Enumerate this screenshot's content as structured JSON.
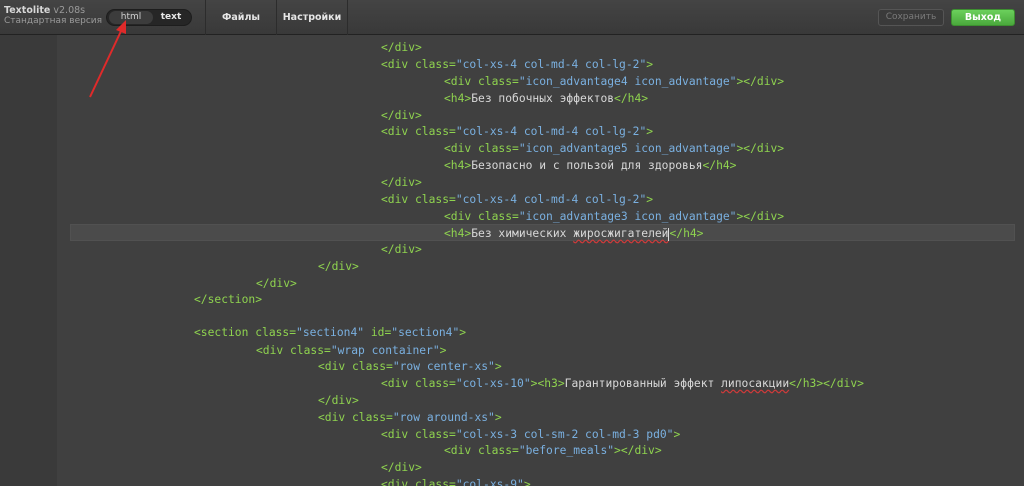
{
  "app": {
    "name": "Textolite",
    "version": "v2.08s",
    "edition": "Стандартная версия"
  },
  "mode_switch": {
    "html_label": "html",
    "text_label": "text",
    "active": "html"
  },
  "menu": {
    "files_label": "Файлы",
    "settings_label": "Настройки"
  },
  "actions": {
    "save_label": "Сохранить",
    "exit_label": "Выход"
  },
  "colors": {
    "tag": "#8fd34f",
    "string": "#7ab0e0",
    "text": "#d8d8d8",
    "exit_button": "#5cbf4a",
    "annotation_arrow": "#e02a2a"
  },
  "code": {
    "line_01": "</div>",
    "line_02": {
      "open": "<div class=",
      "val": "\"col-xs-4 col-md-4 col-lg-2\"",
      "close": ">"
    },
    "line_03": {
      "open": "<div class=",
      "val": "\"icon_advantage4 icon_advantage\"",
      "close": "></div>"
    },
    "line_04": {
      "open": "<h4>",
      "text": "Без побочных эффектов",
      "close": "</h4>"
    },
    "line_05": "</div>",
    "line_06": {
      "open": "<div class=",
      "val": "\"col-xs-4 col-md-4 col-lg-2\"",
      "close": ">"
    },
    "line_07": {
      "open": "<div class=",
      "val": "\"icon_advantage5 icon_advantage\"",
      "close": "></div>"
    },
    "line_08": {
      "open": "<h4>",
      "text": "Безопасно и с пользой для здоровья",
      "close": "</h4>"
    },
    "line_09": "</div>",
    "line_10": {
      "open": "<div class=",
      "val": "\"col-xs-4 col-md-4 col-lg-2\"",
      "close": ">"
    },
    "line_11": {
      "open": "<div class=",
      "val": "\"icon_advantage3 icon_advantage\"",
      "close": "></div>"
    },
    "line_12": {
      "open": "<h4>",
      "text_a": "Без химических ",
      "text_b": "жиросжигателей",
      "close": "</h4>"
    },
    "line_13": "</div>",
    "line_14": "</div>",
    "line_15": "</div>",
    "line_16": "</section>",
    "line_17": {
      "open": "<section class=",
      "val1": "\"section4\"",
      "mid": " id=",
      "val2": "\"section4\"",
      "close": ">"
    },
    "line_18": {
      "open": "<div class=",
      "val": "\"wrap container\"",
      "close": ">"
    },
    "line_19": {
      "open": "<div class=",
      "val": "\"row center-xs\"",
      "close": ">"
    },
    "line_20": {
      "open": "<div class=",
      "val": "\"col-xs-10\"",
      "mid": "><h3>",
      "text_a": "Гарантированный эффект ",
      "text_b": "липосакции",
      "close": "</h3></div>"
    },
    "line_21": "</div>",
    "line_22": {
      "open": "<div class=",
      "val": "\"row around-xs\"",
      "close": ">"
    },
    "line_23": {
      "open": "<div class=",
      "val": "\"col-xs-3 col-sm-2 col-md-3 pd0\"",
      "close": ">"
    },
    "line_24": {
      "open": "<div class=",
      "val": "\"before_meals\"",
      "close": "></div>"
    },
    "line_25": "</div>",
    "line_26": {
      "open": "<div class=",
      "val": "\"col-xs-9\"",
      "close": ">"
    }
  }
}
